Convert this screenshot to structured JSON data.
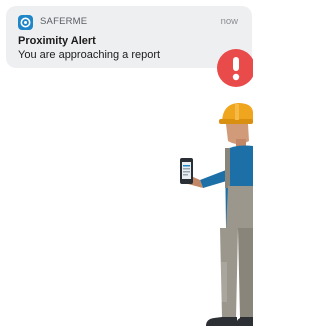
{
  "notification": {
    "app_name": "SAFERME",
    "time": "now",
    "title": "Proximity Alert",
    "body": "You are approaching a report",
    "app_icon": "saferme-app-icon"
  },
  "illustration": {
    "alert_icon": "exclamation-alert-icon",
    "alert_color": "#e94a4a",
    "worker": "construction-worker-illustration",
    "phone": "smartphone-icon"
  },
  "colors": {
    "notification_bg": "#eeeff1",
    "brand_blue": "#1f86c8",
    "hard_hat": "#f0a51f"
  }
}
